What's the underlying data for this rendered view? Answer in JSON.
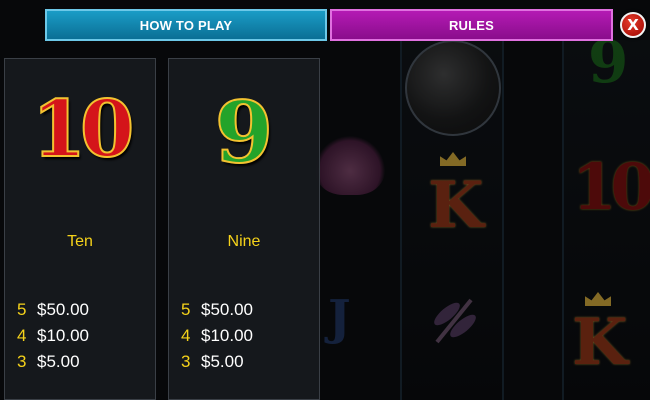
{
  "tabs": {
    "how_to_play": "HOW TO PLAY",
    "rules": "RULES"
  },
  "close_button": {
    "label": "X"
  },
  "paytable": [
    {
      "symbol": "10",
      "name": "Ten",
      "payouts": [
        {
          "count": "5",
          "amount": "$50.00"
        },
        {
          "count": "4",
          "amount": "$10.00"
        },
        {
          "count": "3",
          "amount": "$5.00"
        }
      ]
    },
    {
      "symbol": "9",
      "name": "Nine",
      "payouts": [
        {
          "count": "5",
          "amount": "$50.00"
        },
        {
          "count": "4",
          "amount": "$10.00"
        },
        {
          "count": "3",
          "amount": "$5.00"
        }
      ]
    }
  ],
  "colors": {
    "how_to_play_tab": "#0b8ab5",
    "rules_tab": "#a012a2",
    "close_button": "#c8180e",
    "label_yellow": "#f5d21a"
  }
}
